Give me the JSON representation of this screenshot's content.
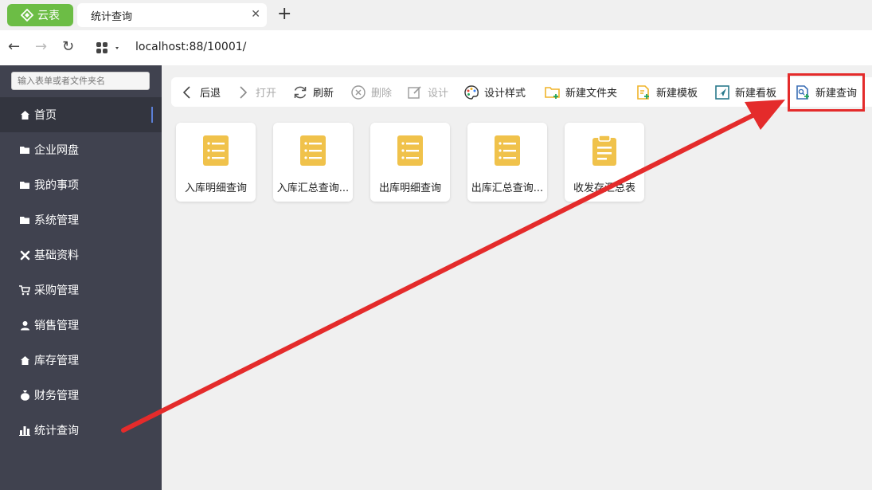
{
  "browser": {
    "app_name": "云表",
    "tab_title": "统计查询",
    "address": "localhost:88/10001/"
  },
  "sidebar": {
    "search_placeholder": "输入表单或者文件夹名",
    "items": [
      {
        "label": "首页",
        "icon": "home-icon",
        "active": true
      },
      {
        "label": "企业网盘",
        "icon": "folder-icon"
      },
      {
        "label": "我的事项",
        "icon": "folder-icon"
      },
      {
        "label": "系统管理",
        "icon": "folder-icon"
      },
      {
        "label": "基础资料",
        "icon": "tools-icon"
      },
      {
        "label": "采购管理",
        "icon": "cart-icon"
      },
      {
        "label": "销售管理",
        "icon": "user-icon"
      },
      {
        "label": "库存管理",
        "icon": "home-icon"
      },
      {
        "label": "财务管理",
        "icon": "money-bag-icon"
      },
      {
        "label": "统计查询",
        "icon": "bar-chart-icon"
      }
    ]
  },
  "toolbar": {
    "back": "后退",
    "open": "打开",
    "refresh": "刷新",
    "delete": "删除",
    "design": "设计",
    "design_style": "设计样式",
    "new_folder": "新建文件夹",
    "new_template": "新建模板",
    "new_dashboard": "新建看板",
    "new_query": "新建查询"
  },
  "cards": [
    {
      "label": "入库明细查询",
      "icon": "list-doc-icon"
    },
    {
      "label": "入库汇总查询...",
      "icon": "list-doc-icon"
    },
    {
      "label": "出库明细查询",
      "icon": "list-doc-icon"
    },
    {
      "label": "出库汇总查询...",
      "icon": "list-doc-icon"
    },
    {
      "label": "收发存汇总表",
      "icon": "clipboard-icon"
    }
  ],
  "colors": {
    "brand_green": "#6cbd45",
    "sidebar_bg": "#40424f",
    "card_icon_yellow": "#f0c24b",
    "highlight_red": "#e42b2b"
  }
}
